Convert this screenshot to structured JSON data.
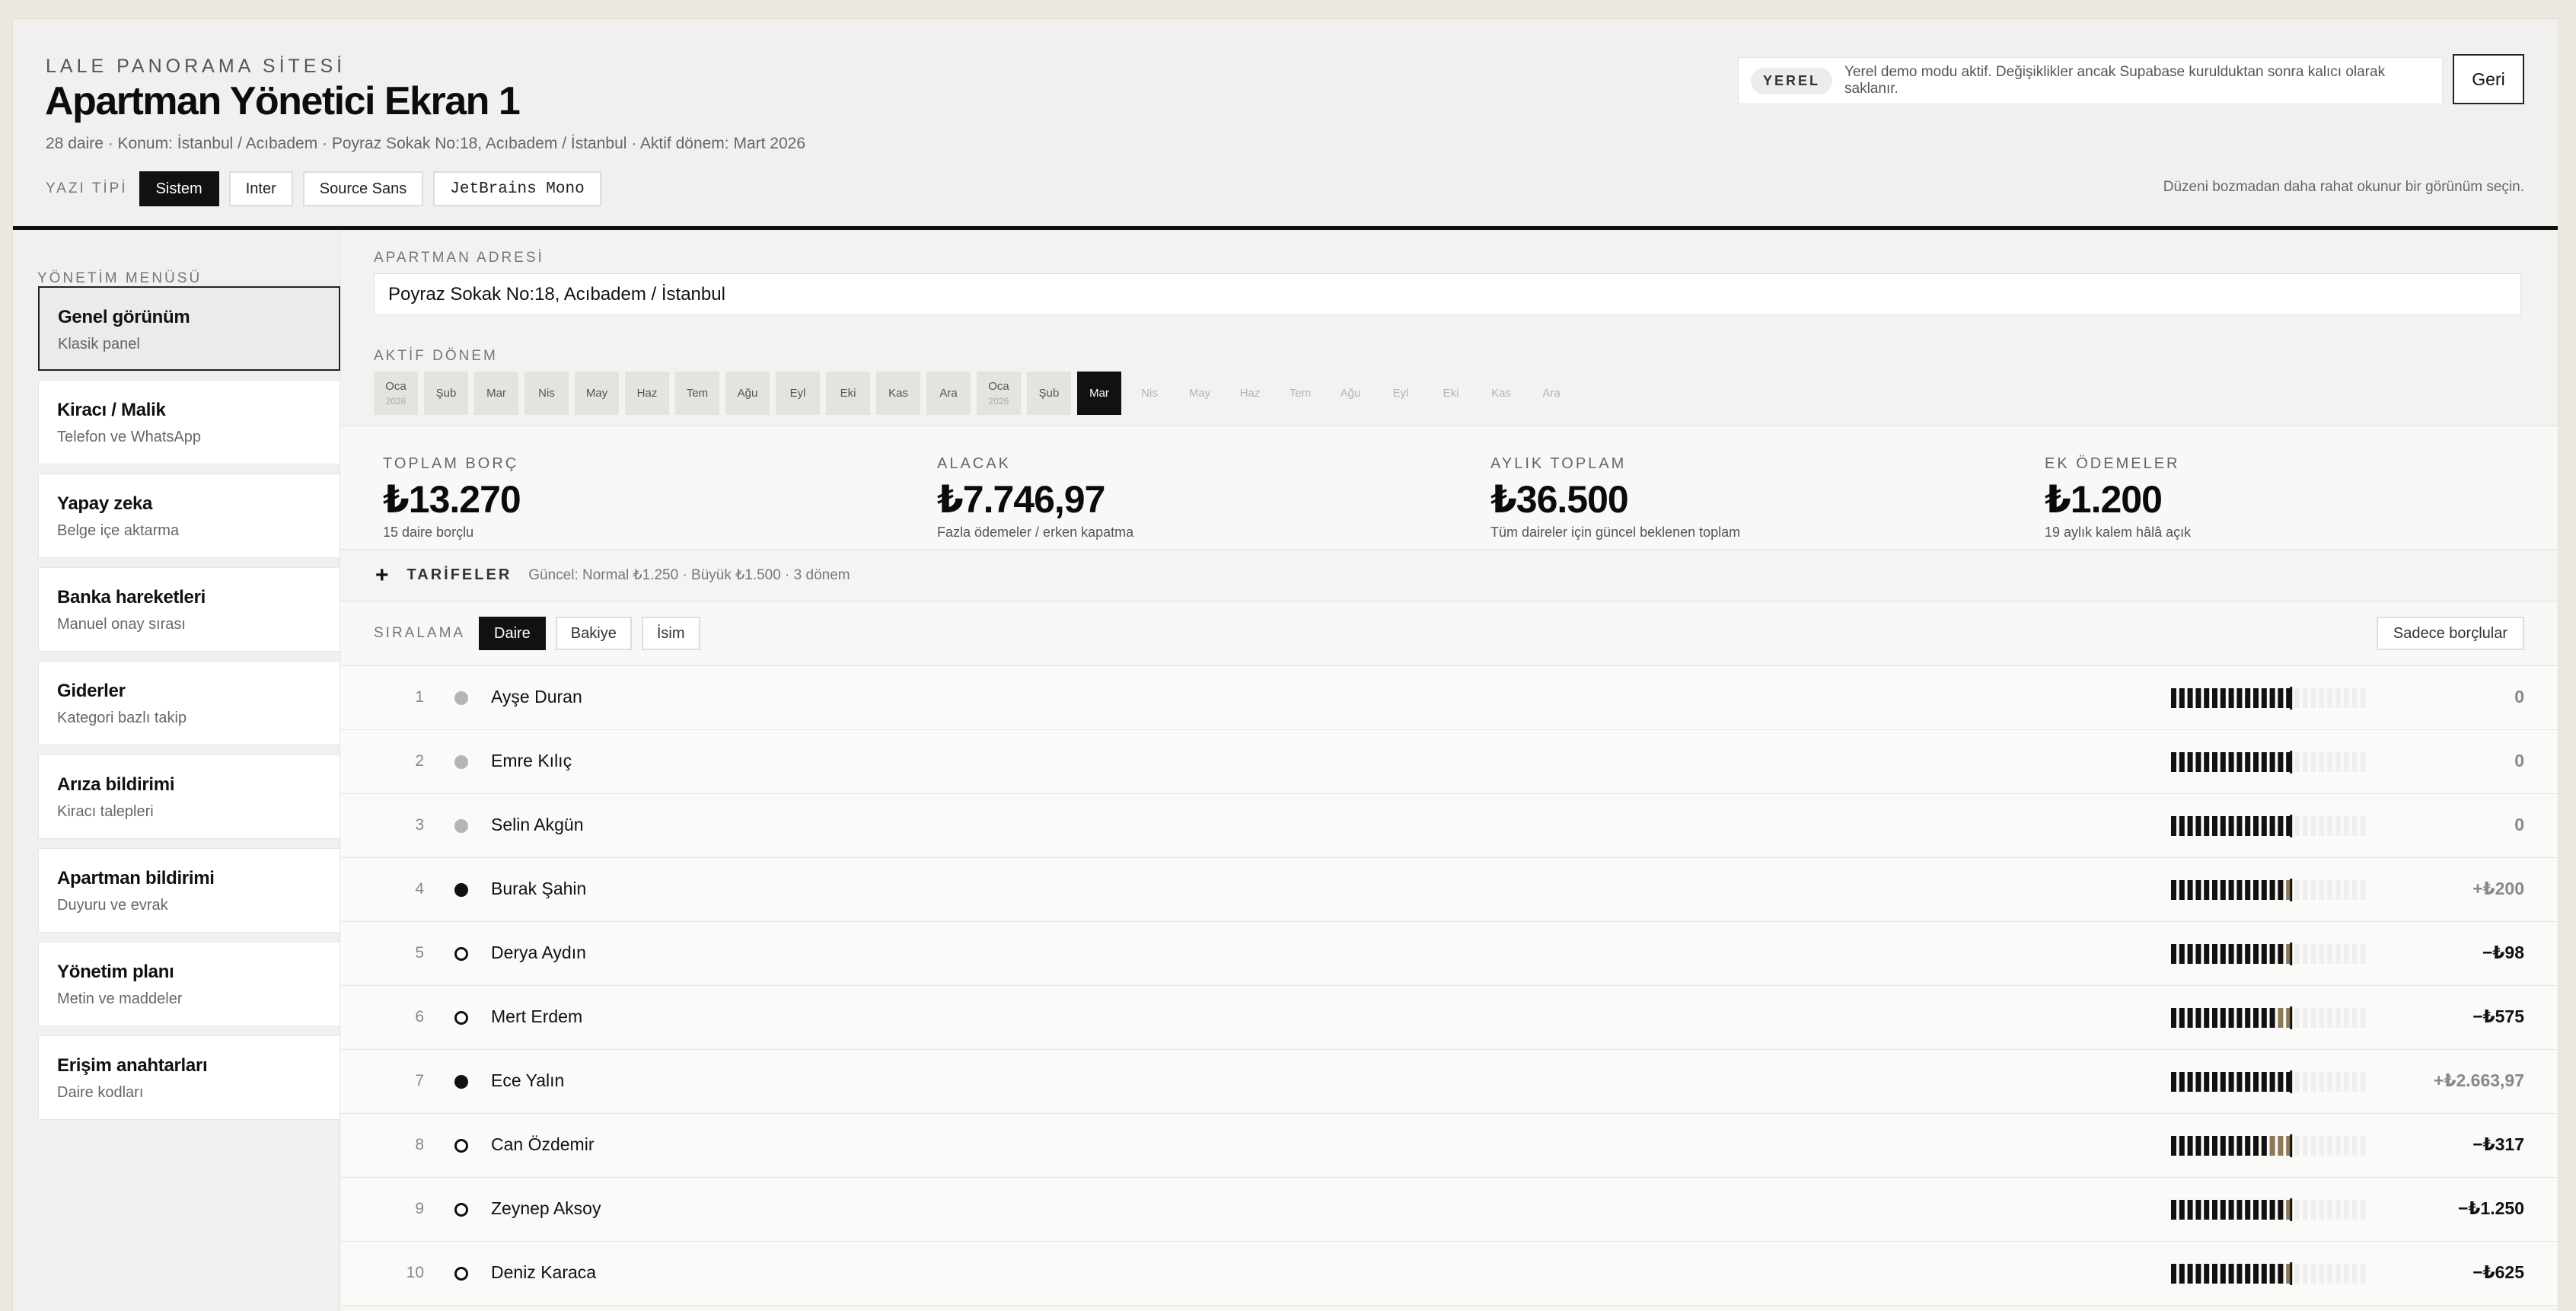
{
  "header": {
    "site_name": "LALE PANORAMA SİTESİ",
    "title": "Apartman Yönetici Ekran 1",
    "meta": "28 daire · Konum: İstanbul / Acıbadem · Poyraz Sokak No:18, Acıbadem / İstanbul · Aktif dönem: Mart 2026",
    "font_label": "YAZI TİPİ",
    "fonts": [
      "Sistem",
      "Inter",
      "Source Sans",
      "JetBrains Mono"
    ],
    "active_font": "Sistem",
    "notice_badge": "YEREL",
    "notice_text": "Yerel demo modu aktif. Değişiklikler ancak Supabase kurulduktan sonra kalıcı olarak saklanır.",
    "back_label": "Geri",
    "hint": "Düzeni bozmadan daha rahat okunur bir görünüm seçin."
  },
  "sidebar": {
    "label": "YÖNETİM MENÜSÜ",
    "items": [
      {
        "title": "Genel görünüm",
        "sub": "Klasik panel",
        "active": true
      },
      {
        "title": "Kiracı / Malik",
        "sub": "Telefon ve WhatsApp"
      },
      {
        "title": "Yapay zeka",
        "sub": "Belge içe aktarma"
      },
      {
        "title": "Banka hareketleri",
        "sub": "Manuel onay sırası"
      },
      {
        "title": "Giderler",
        "sub": "Kategori bazlı takip"
      },
      {
        "title": "Arıza bildirimi",
        "sub": "Kiracı talepleri"
      },
      {
        "title": "Apartman bildirimi",
        "sub": "Duyuru ve evrak"
      },
      {
        "title": "Yönetim planı",
        "sub": "Metin ve maddeler"
      },
      {
        "title": "Erişim anahtarları",
        "sub": "Daire kodları"
      }
    ]
  },
  "address": {
    "label": "APARTMAN ADRESİ",
    "value": "Poyraz Sokak No:18, Acıbadem / İstanbul"
  },
  "periods": {
    "label": "AKTİF DÖNEM",
    "items": [
      {
        "m": "Oca",
        "y": "2026",
        "state": "past"
      },
      {
        "m": "Şub",
        "state": "past"
      },
      {
        "m": "Mar",
        "state": "past"
      },
      {
        "m": "Nis",
        "state": "past"
      },
      {
        "m": "May",
        "state": "past"
      },
      {
        "m": "Haz",
        "state": "past"
      },
      {
        "m": "Tem",
        "state": "past"
      },
      {
        "m": "Ağu",
        "state": "past"
      },
      {
        "m": "Eyl",
        "state": "past"
      },
      {
        "m": "Eki",
        "state": "past"
      },
      {
        "m": "Kas",
        "state": "past"
      },
      {
        "m": "Ara",
        "state": "past"
      },
      {
        "m": "Oca",
        "y": "2026",
        "state": "past"
      },
      {
        "m": "Şub",
        "state": "past"
      },
      {
        "m": "Mar",
        "state": "active"
      },
      {
        "m": "Nis",
        "state": "future"
      },
      {
        "m": "May",
        "state": "future"
      },
      {
        "m": "Haz",
        "state": "future"
      },
      {
        "m": "Tem",
        "state": "future"
      },
      {
        "m": "Ağu",
        "state": "future"
      },
      {
        "m": "Eyl",
        "state": "future"
      },
      {
        "m": "Eki",
        "state": "future"
      },
      {
        "m": "Kas",
        "state": "future"
      },
      {
        "m": "Ara",
        "state": "future"
      }
    ]
  },
  "stats": [
    {
      "label": "TOPLAM BORÇ",
      "value": "₺13.270",
      "sub": "15 daire borçlu"
    },
    {
      "label": "ALACAK",
      "value": "₺7.746,97",
      "sub": "Fazla ödemeler / erken kapatma"
    },
    {
      "label": "AYLIK TOPLAM",
      "value": "₺36.500",
      "sub": "Tüm daireler için güncel beklenen toplam"
    },
    {
      "label": "EK ÖDEMELER",
      "value": "₺1.200",
      "sub": "19 aylık kalem hâlâ açık"
    }
  ],
  "tariffs": {
    "title": "TARİFELER",
    "info": "Güncel: Normal ₺1.250 · Büyük ₺1.500 · 3 dönem"
  },
  "sorting": {
    "label": "SIRALAMA",
    "options": [
      "Daire",
      "Bakiye",
      "İsim"
    ],
    "active": "Daire",
    "only_debtors": "Sadece borçlular"
  },
  "residents": [
    {
      "no": "1",
      "name": "Ayşe Duran",
      "status": "paid",
      "amount": "0"
    },
    {
      "no": "2",
      "name": "Emre Kılıç",
      "status": "paid",
      "amount": "0"
    },
    {
      "no": "3",
      "name": "Selin Akgün",
      "status": "paid",
      "amount": "0"
    },
    {
      "no": "4",
      "name": "Burak Şahin",
      "status": "credit",
      "amount": "+₺200"
    },
    {
      "no": "5",
      "name": "Derya Aydın",
      "status": "owes",
      "amount": "−₺98"
    },
    {
      "no": "6",
      "name": "Mert Erdem",
      "status": "owes",
      "amount": "−₺575"
    },
    {
      "no": "7",
      "name": "Ece Yalın",
      "status": "credit",
      "amount": "+₺2.663,97"
    },
    {
      "no": "8",
      "name": "Can Özdemir",
      "status": "owes",
      "amount": "−₺317"
    },
    {
      "no": "9",
      "name": "Zeynep Aksoy",
      "status": "owes",
      "amount": "−₺1.250"
    },
    {
      "no": "10",
      "name": "Deniz Karaca",
      "status": "owes",
      "amount": "−₺625"
    }
  ],
  "colors": {
    "accent": "#111111",
    "partial": "#8c7a55",
    "muted": "#888888"
  }
}
